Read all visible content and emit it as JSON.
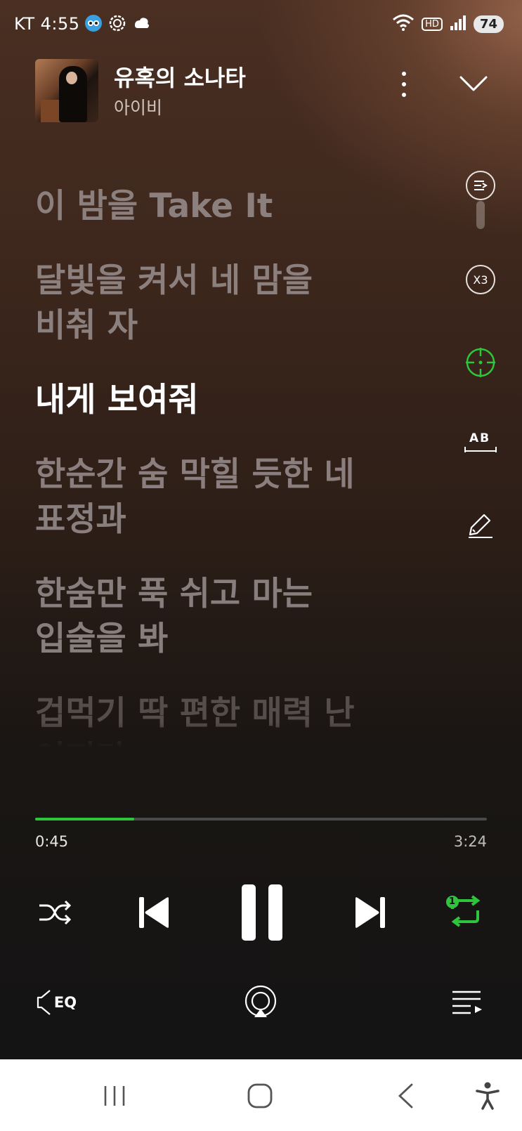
{
  "status_bar": {
    "carrier_time": "KT 4:55",
    "notification_icons": [
      "app-notification-icon",
      "settings-notification-icon",
      "cloud-notification-icon"
    ],
    "network": "HD",
    "battery": "74"
  },
  "now_playing": {
    "title": "유혹의 소나타",
    "artist": "아이비"
  },
  "lyrics": [
    {
      "text": "이 밤을 Take It",
      "active": false
    },
    {
      "text": "달빛을 켜서 네 맘을\n비춰 자",
      "active": false
    },
    {
      "text": "내게 보여줘",
      "active": true
    },
    {
      "text": "한순간 숨 막힐 듯한 네\n표정과",
      "active": false
    },
    {
      "text": "한숨만 푹 쉬고 마는\n입술을 봐",
      "active": false
    },
    {
      "text": "겁먹기 딱 편한 매력 난\n이지만",
      "active": false
    }
  ],
  "side_tools": {
    "lyric_size_label": "X3",
    "translate_label": "AB"
  },
  "playback": {
    "elapsed": "0:45",
    "total": "3:24",
    "progress": 0.22,
    "repeat_badge": "1",
    "accent_color": "#2ec43b"
  },
  "bottom_tools": {
    "eq_label": "EQ"
  }
}
